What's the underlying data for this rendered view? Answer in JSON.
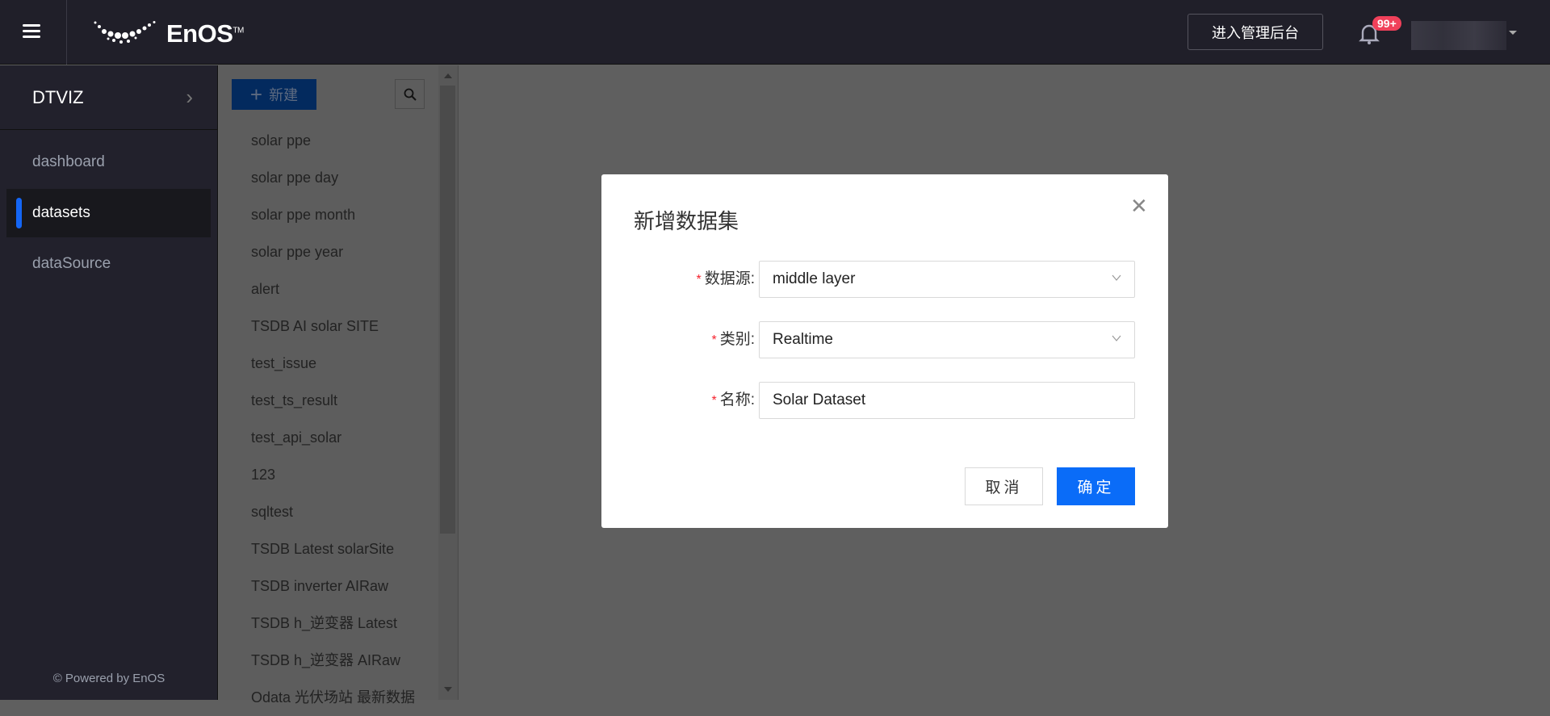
{
  "header": {
    "brand": "EnOS",
    "trademark": "TM",
    "admin_button": "进入管理后台",
    "notification_count": "99+"
  },
  "sidebar": {
    "app_title": "DTVIZ",
    "items": [
      {
        "label": "dashboard"
      },
      {
        "label": "datasets"
      },
      {
        "label": "dataSource"
      }
    ],
    "footer": "© Powered by EnOS"
  },
  "list": {
    "new_label": "新建",
    "items": [
      "solar ppe",
      "solar ppe day",
      "solar ppe month",
      "solar ppe year",
      "alert",
      "TSDB AI solar SITE",
      "test_issue",
      "test_ts_result",
      "test_api_solar",
      "123",
      "sqltest",
      "TSDB Latest solarSite",
      "TSDB inverter AIRaw",
      "TSDB h_逆变器 Latest",
      "TSDB h_逆变器 AIRaw",
      "Odata 光伏场站 最新数据"
    ]
  },
  "modal": {
    "title": "新增数据集",
    "fields": [
      {
        "label": "数据源:",
        "value": "middle layer"
      },
      {
        "label": "类别:",
        "value": "Realtime"
      },
      {
        "label": "名称:",
        "value": "Solar Dataset"
      }
    ],
    "required_mark": "*",
    "cancel": "取消",
    "ok": "确定"
  },
  "colors": {
    "accent": "#0a6cf8",
    "header_bg": "#201f29",
    "badge": "#f0405a"
  }
}
